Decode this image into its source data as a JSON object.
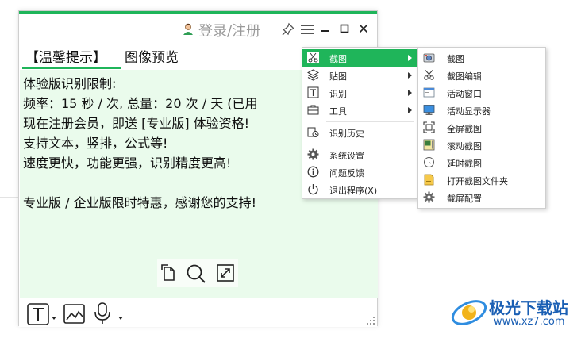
{
  "colors": {
    "accent": "#1fb55a",
    "content_bg": "#eafbec",
    "watermark": "#1a5fb4"
  },
  "titlebar": {
    "login_text": "登录/注册",
    "icons": [
      "user-icon",
      "pin-icon",
      "menu-icon",
      "minimize-icon",
      "maximize-icon",
      "close-icon"
    ]
  },
  "tabs": [
    {
      "label": "【温馨提示】"
    },
    {
      "label": "图像预览"
    }
  ],
  "content": {
    "lines": [
      "体验版识别限制:",
      "频率：15 秒 / 次, 总量：20 次 / 天 (已用",
      "现在注册会员，即送 [专业版] 体验资格!",
      "支持文本，竖排，公式等!",
      "速度更快，功能更强，识别精度更高!",
      "",
      "专业版 / 企业版限时特惠，感谢您的支持!"
    ]
  },
  "toolstrip": {
    "icons": [
      "copy-icon",
      "search-icon",
      "expand-icon"
    ]
  },
  "bottombar": {
    "icons": [
      "text-mode-icon",
      "image-mode-icon",
      "microphone-icon"
    ]
  },
  "context_menu": {
    "items": [
      {
        "label": "截图",
        "icon": "scissors-icon",
        "submenu": true,
        "active": true
      },
      {
        "label": "贴图",
        "icon": "layers-icon",
        "submenu": true
      },
      {
        "label": "识别",
        "icon": "text-recognize-icon",
        "submenu": true
      },
      {
        "label": "工具",
        "icon": "toolbox-icon",
        "submenu": true
      },
      {
        "label": "识别历史",
        "icon": "history-icon"
      },
      {
        "label": "系统设置",
        "icon": "gear-icon"
      },
      {
        "label": "问题反馈",
        "icon": "info-icon"
      },
      {
        "label": "退出程序(X)",
        "icon": "power-icon"
      }
    ]
  },
  "screenshot_submenu": {
    "items": [
      {
        "label": "截图",
        "icon": "camera-icon"
      },
      {
        "label": "截图编辑",
        "icon": "scissors-edit-icon"
      },
      {
        "label": "活动窗口",
        "icon": "window-icon"
      },
      {
        "label": "活动显示器",
        "icon": "monitor-icon"
      },
      {
        "label": "全屏截图",
        "icon": "fullscreen-icon"
      },
      {
        "label": "滚动截图",
        "icon": "scroll-capture-icon"
      },
      {
        "label": "延时截图",
        "icon": "clock-icon"
      },
      {
        "label": "打开截图文件夹",
        "icon": "folder-icon"
      },
      {
        "label": "截屏配置",
        "icon": "gear-icon"
      }
    ]
  },
  "watermark": {
    "title": "极光下载站",
    "url": "www.xz7.com"
  }
}
